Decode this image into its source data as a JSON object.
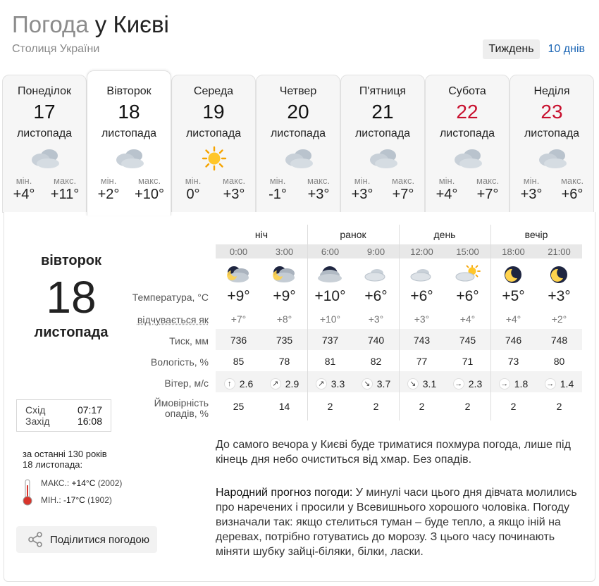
{
  "header": {
    "title_prefix": "Погода",
    "title_city": "у Києві",
    "subtitle": "Столиця України"
  },
  "range": {
    "week": "Тиждень",
    "ten_days": "10 днів"
  },
  "week": [
    {
      "name": "Понеділок",
      "num": "17",
      "month": "листопада",
      "icon": "cloud-icon",
      "min_label": "мін.",
      "max_label": "макс.",
      "min": "+4°",
      "max": "+11°"
    },
    {
      "name": "Вівторок",
      "num": "18",
      "month": "листопада",
      "icon": "cloud-icon",
      "min_label": "мін.",
      "max_label": "макс.",
      "min": "+2°",
      "max": "+10°"
    },
    {
      "name": "Середа",
      "num": "19",
      "month": "листопада",
      "icon": "sun-icon",
      "min_label": "мін.",
      "max_label": "макс.",
      "min": "0°",
      "max": "+3°"
    },
    {
      "name": "Четвер",
      "num": "20",
      "month": "листопада",
      "icon": "cloud-icon",
      "min_label": "мін.",
      "max_label": "макс.",
      "min": "-1°",
      "max": "+3°"
    },
    {
      "name": "П'ятниця",
      "num": "21",
      "month": "листопада",
      "icon": "cloud-icon",
      "min_label": "мін.",
      "max_label": "макс.",
      "min": "+3°",
      "max": "+7°"
    },
    {
      "name": "Субота",
      "num": "22",
      "month": "листопада",
      "icon": "cloud-icon",
      "min_label": "мін.",
      "max_label": "макс.",
      "min": "+4°",
      "max": "+7°"
    },
    {
      "name": "Неділя",
      "num": "23",
      "month": "листопада",
      "icon": "cloud-icon",
      "min_label": "мін.",
      "max_label": "макс.",
      "min": "+3°",
      "max": "+6°"
    }
  ],
  "selected": {
    "weekday": "вівторок",
    "num": "18",
    "month": "листопада",
    "sunrise_label": "Схід",
    "sunrise": "07:17",
    "sunset_label": "Захід",
    "sunset": "16:08",
    "history_head1": "за останні 130 років",
    "history_head2": "18 листопада:",
    "hist_max_label": "МАКС.:",
    "hist_max_val": "+14°C",
    "hist_max_year": "(2002)",
    "hist_min_label": "МІН.:",
    "hist_min_val": "-17°C",
    "hist_min_year": "(1902)",
    "share": "Поділитися погодою"
  },
  "labels": {
    "temp": "Температура, °C",
    "feels": "відчувається як",
    "pressure": "Тиск, мм",
    "humidity": "Вологість, %",
    "wind": "Вітер, м/c",
    "precip1": "Ймовірність",
    "precip2": "опадів, %"
  },
  "periods": [
    "ніч",
    "ранок",
    "день",
    "вечір"
  ],
  "hours": [
    {
      "time": "0:00",
      "icon": "cloudy-night-icon",
      "temp": "+9°",
      "feels": "+7°",
      "pressure": "736",
      "humidity": "85",
      "wind_dir": "↑",
      "wind": "2.6",
      "precip": "25"
    },
    {
      "time": "3:00",
      "icon": "cloudy-night-icon",
      "temp": "+9°",
      "feels": "+8°",
      "pressure": "735",
      "humidity": "78",
      "wind_dir": "↗",
      "wind": "2.9",
      "precip": "14"
    },
    {
      "time": "6:00",
      "icon": "overcast-night-icon",
      "temp": "+10°",
      "feels": "+10°",
      "pressure": "737",
      "humidity": "81",
      "wind_dir": "↗",
      "wind": "3.3",
      "precip": "2"
    },
    {
      "time": "9:00",
      "icon": "light-cloud-icon",
      "temp": "+6°",
      "feels": "+3°",
      "pressure": "740",
      "humidity": "82",
      "wind_dir": "↘",
      "wind": "3.7",
      "precip": "2"
    },
    {
      "time": "12:00",
      "icon": "light-cloud-icon",
      "temp": "+6°",
      "feels": "+3°",
      "pressure": "743",
      "humidity": "77",
      "wind_dir": "↘",
      "wind": "3.1",
      "precip": "2"
    },
    {
      "time": "15:00",
      "icon": "sun-cloud-icon",
      "temp": "+6°",
      "feels": "+4°",
      "pressure": "745",
      "humidity": "71",
      "wind_dir": "→",
      "wind": "2.3",
      "precip": "2"
    },
    {
      "time": "18:00",
      "icon": "moon-icon",
      "temp": "+5°",
      "feels": "+4°",
      "pressure": "746",
      "humidity": "73",
      "wind_dir": "→",
      "wind": "1.8",
      "precip": "2"
    },
    {
      "time": "21:00",
      "icon": "moon-icon",
      "temp": "+3°",
      "feels": "+2°",
      "pressure": "748",
      "humidity": "80",
      "wind_dir": "→",
      "wind": "1.4",
      "precip": "2"
    }
  ],
  "description": "До самого вечора у Києві буде триматися похмура погода, лише під кінець дня небо очиститься від хмар. Без опадів.",
  "folk_head": "Народний прогноз погоди:",
  "folk_text": " У минулі часи цього дня дівчата молились про наречених і просили у Всевишнього хорошого чоловіка. Погоду визначали так: якщо стелиться туман – буде тепло, а якщо іній на деревах, потрібно готуватись до морозу. З цього часу починають міняти шубку зайці-біляки, білки, ласки.",
  "colors": {
    "weekend": "#c8102e",
    "link": "#1c66b5"
  }
}
